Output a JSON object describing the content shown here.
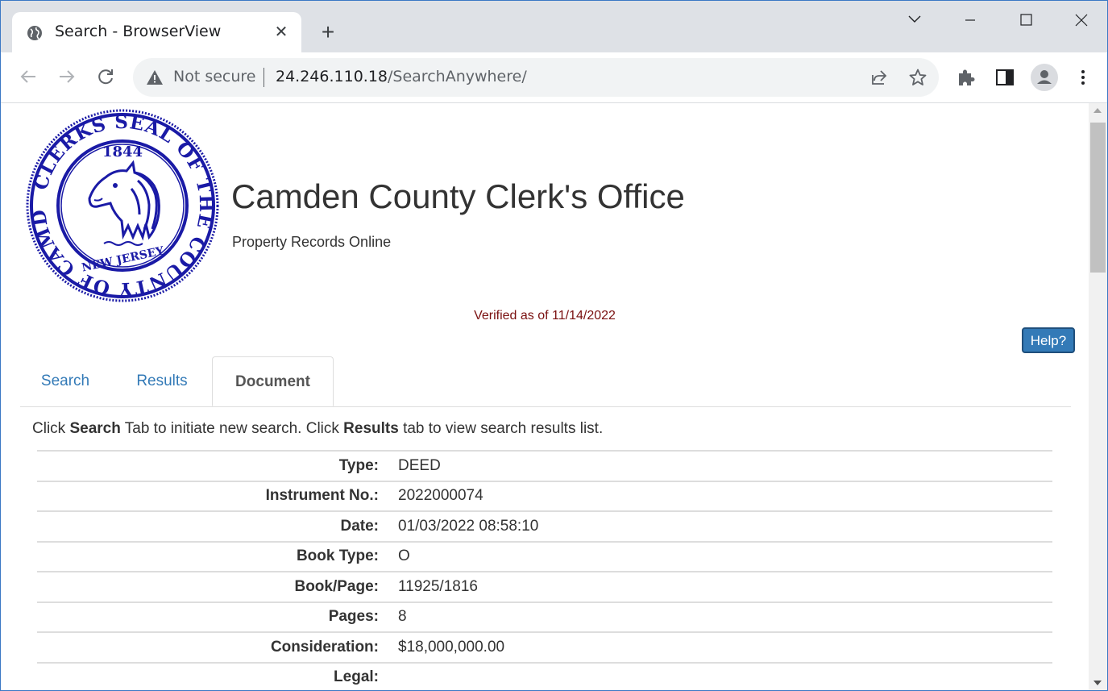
{
  "browser": {
    "tab_title": "Search - BrowserView",
    "security_label": "Not secure",
    "url_host": "24.246.110.18",
    "url_path": "/SearchAnywhere/"
  },
  "page": {
    "title": "Camden County Clerk's Office",
    "subtitle": "Property Records Online",
    "verified": "Verified as of 11/14/2022",
    "help_label": "Help?",
    "tabs": [
      {
        "label": "Search",
        "active": false
      },
      {
        "label": "Results",
        "active": false
      },
      {
        "label": "Document",
        "active": true
      }
    ],
    "instruction": {
      "p1": "Click ",
      "b1": "Search",
      "p2": " Tab to initiate new search. Click ",
      "b2": "Results",
      "p3": " tab to view search results list."
    },
    "document_rows": [
      {
        "label": "Type:",
        "value": "DEED"
      },
      {
        "label": "Instrument No.:",
        "value": "2022000074"
      },
      {
        "label": "Date:",
        "value": "01/03/2022 08:58:10"
      },
      {
        "label": "Book Type:",
        "value": "O"
      },
      {
        "label": "Book/Page:",
        "value": "11925/1816"
      },
      {
        "label": "Pages:",
        "value": "8"
      },
      {
        "label": "Consideration:",
        "value": "$18,000,000.00"
      },
      {
        "label": "Legal:",
        "value": ""
      }
    ],
    "seal": {
      "year": "1844",
      "ring_text": "CLERKS SEAL OF THE COUNTY OF CAMDEN",
      "state": "NEW JERSEY",
      "color": "#1a1aa6"
    }
  },
  "colors": {
    "link": "#337ab7",
    "verified": "#7a1010",
    "help_bg": "#337ab7"
  }
}
